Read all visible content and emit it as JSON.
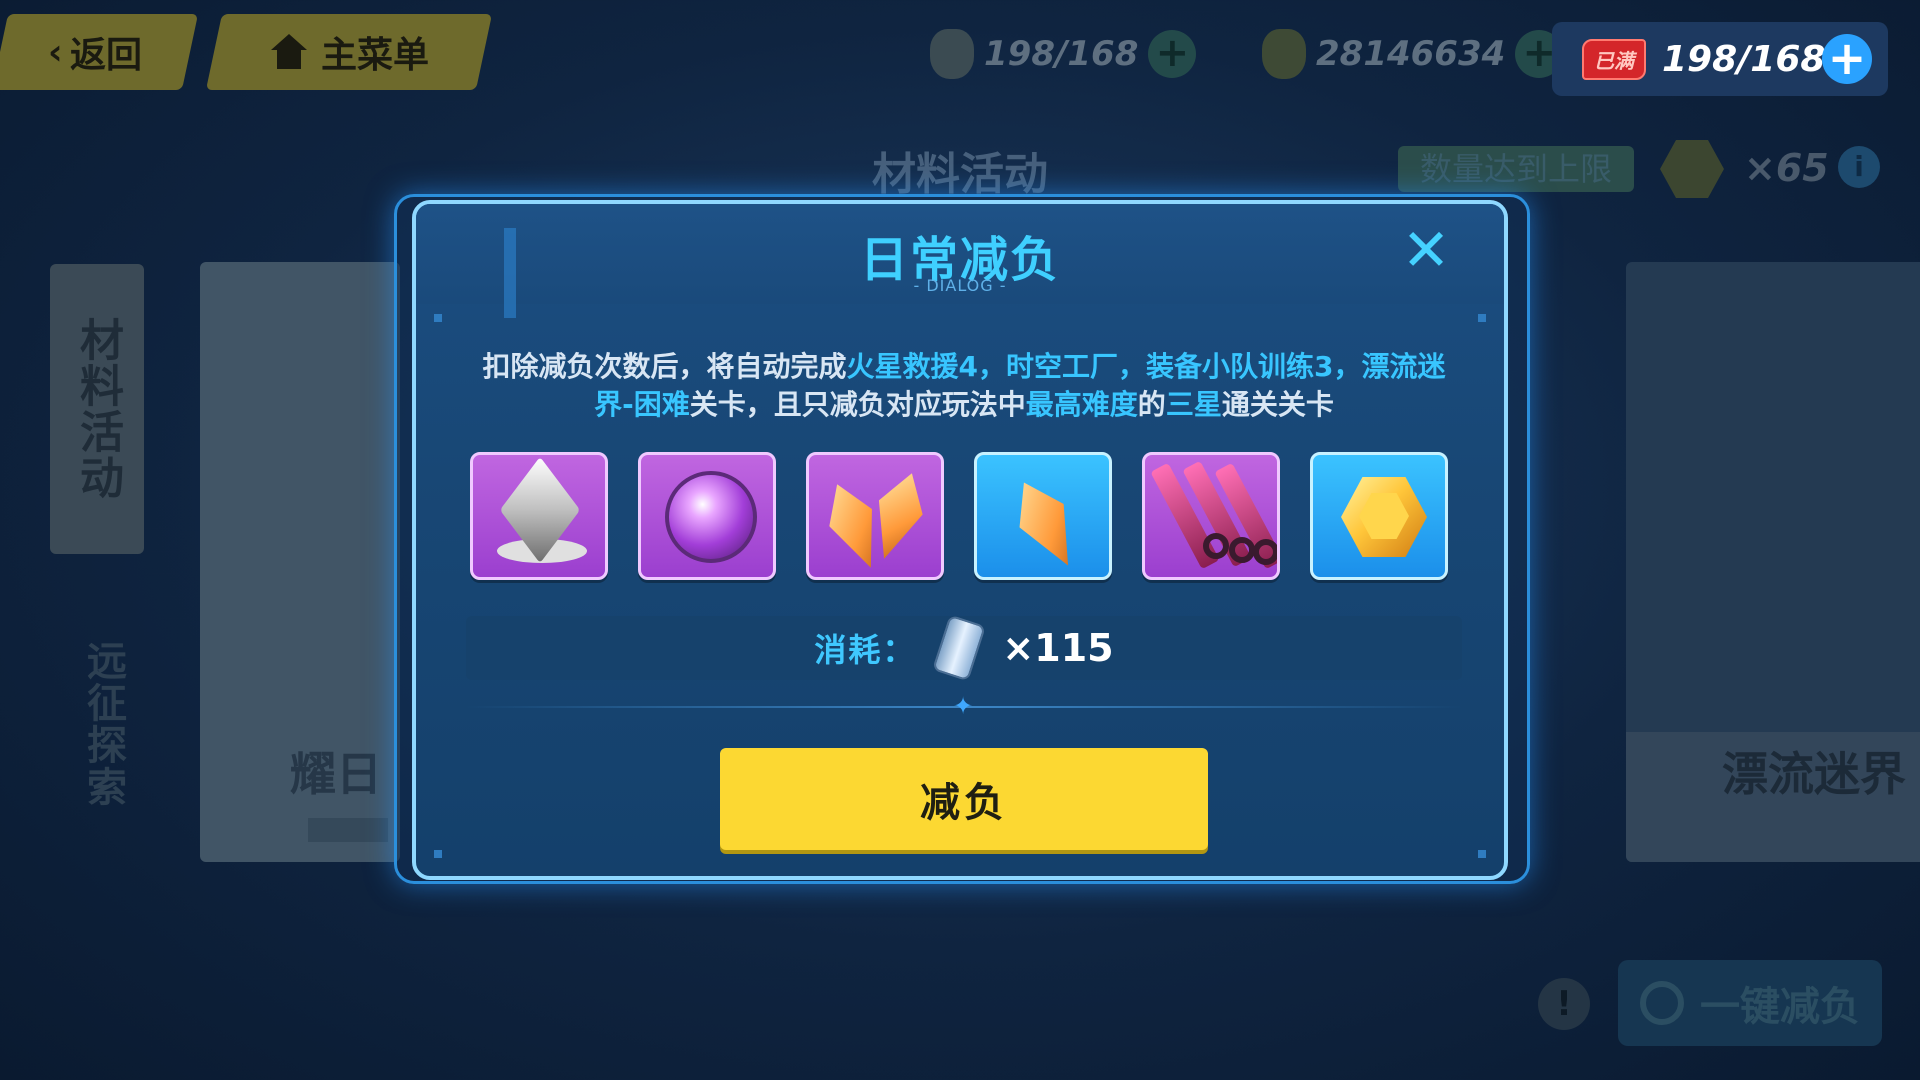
{
  "topbar": {
    "back_label": "返回",
    "main_menu_label": "主菜单",
    "resource1_value": "198/168",
    "resource2_value": "28146634",
    "stamina_badge": "已满",
    "stamina_value": "198/168"
  },
  "background": {
    "panel_title": "材料活动",
    "limit_text": "数量达到上限",
    "coin_count": "×65",
    "sidetab_active": "材料活动",
    "sidetab_other": "远征探索",
    "card_left_caption": "耀日",
    "card_right_caption": "漂流迷界",
    "one_click_label": "一键减负"
  },
  "dialog": {
    "title": "日常减负",
    "subtitle": "- DIALOG -",
    "close_symbol": "✕",
    "desc": {
      "p1": "扣除减负次数后，将自动完成",
      "h1": "火星救援4，时空工厂，装备小队训练3，漂流迷界-困难",
      "p2": "关卡，且只减负对应玩法中",
      "h2": "最高难度",
      "p3": "的",
      "h3": "三星",
      "p4": "通关关卡"
    },
    "items": [
      {
        "icon": "silver-cube-icon",
        "rarity": "purple"
      },
      {
        "icon": "purple-orb-icon",
        "rarity": "purple"
      },
      {
        "icon": "orange-crystals-icon",
        "rarity": "purple"
      },
      {
        "icon": "orange-crystal-icon",
        "rarity": "blue"
      },
      {
        "icon": "pink-pins-icon",
        "rarity": "purple"
      },
      {
        "icon": "gold-hex-coin-icon",
        "rarity": "blue"
      }
    ],
    "cost_label": "消耗：",
    "cost_value": "×115",
    "confirm_label": "减负"
  },
  "colors": {
    "accent_cyan": "#3fd0ff",
    "button_yellow": "#fcd832",
    "purple_rarity": "#a54ad6",
    "blue_rarity": "#2aa6f5",
    "stamina_full_red": "#d4262a"
  }
}
